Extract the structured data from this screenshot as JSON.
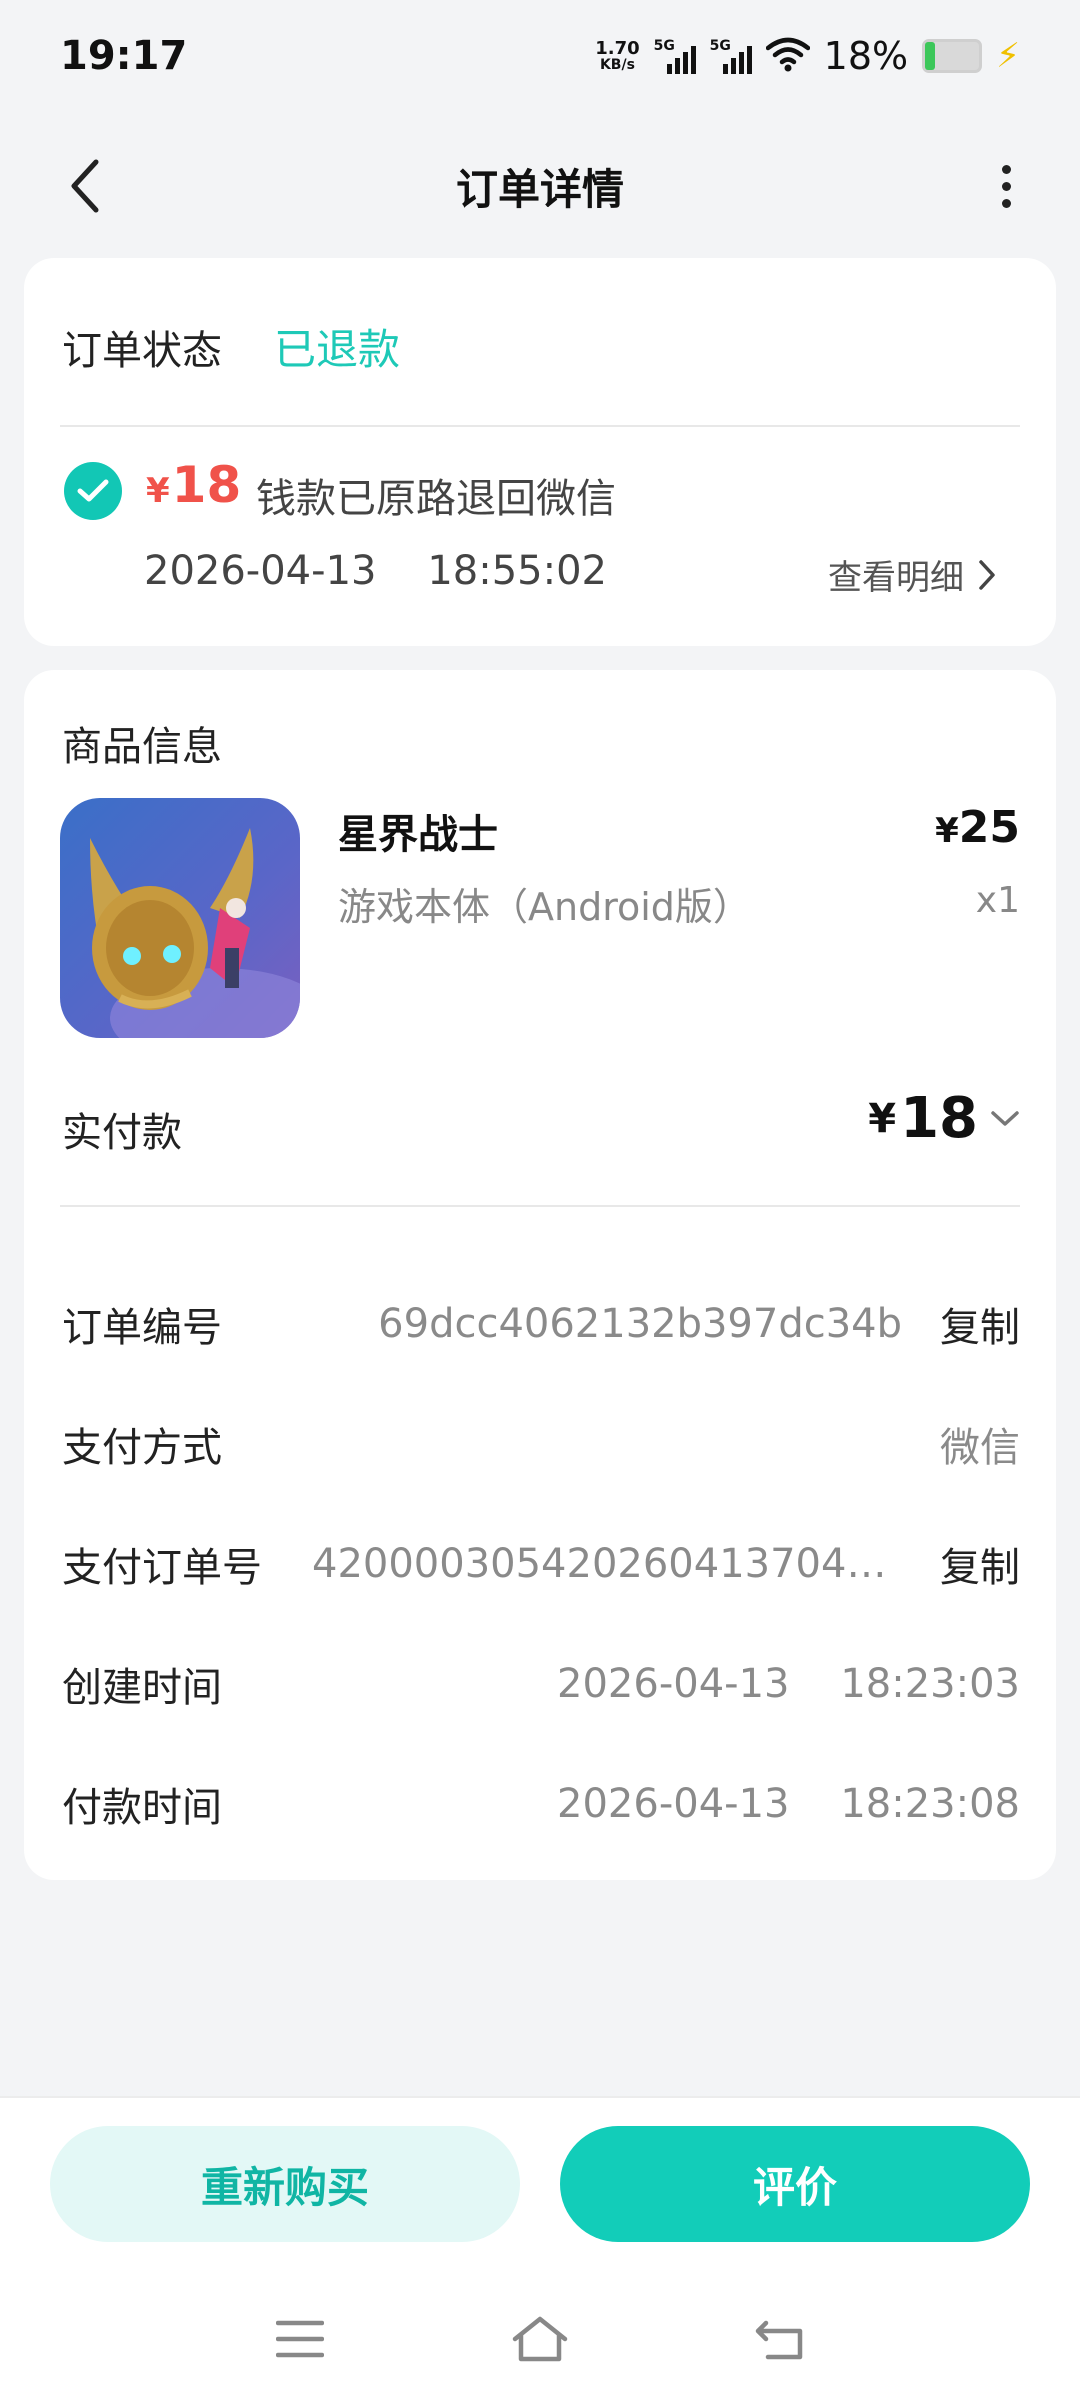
{
  "status_bar": {
    "time": "19:17",
    "net_speed_value": "1.70",
    "net_speed_unit": "KB/s",
    "sim1_tag": "5G",
    "sim2_tag": "5G",
    "battery_percent": "18%",
    "battery_level": 0.18,
    "icons": [
      "wifi-icon",
      "battery-icon",
      "charging-bolt-icon"
    ]
  },
  "header": {
    "title": "订单详情"
  },
  "order_status": {
    "label": "订单状态",
    "value": "已退款",
    "refund_currency": "¥",
    "refund_amount": "18",
    "refund_text": "钱款已原路退回微信",
    "refund_time": "2026-04-13    18:55:02",
    "view_detail": "查看明细"
  },
  "product": {
    "section_title": "商品信息",
    "name": "星界战士",
    "edition": "游戏本体（Android版）",
    "price_currency": "¥",
    "price": "25",
    "quantity": "x1"
  },
  "payment": {
    "paid_label": "实付款",
    "paid_currency": "¥",
    "paid_amount": "18"
  },
  "details": {
    "order_no_label": "订单编号",
    "order_no": "69dcc4062132b397dc34b",
    "copy_label": "复制",
    "pay_method_label": "支付方式",
    "pay_method": "微信",
    "pay_order_label": "支付订单号",
    "pay_order_no": "4200003054202604137047…",
    "created_label": "创建时间",
    "created_time": "2026-04-13    18:23:03",
    "paid_time_label": "付款时间",
    "paid_time": "2026-04-13    18:23:08"
  },
  "actions": {
    "rebuy": "重新购买",
    "review": "评价"
  },
  "colors": {
    "accent": "#12cdb9",
    "refund_red": "#f0524a",
    "background": "#f3f4f6"
  }
}
